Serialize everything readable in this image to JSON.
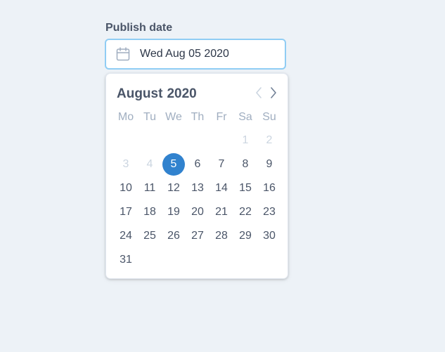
{
  "field": {
    "label": "Publish date",
    "value": "Wed Aug 05 2020",
    "icon": "calendar-icon"
  },
  "calendar": {
    "month": "August",
    "year": "2020",
    "prev_icon": "chevron-left-icon",
    "next_icon": "chevron-right-icon",
    "weekdays": [
      "Mo",
      "Tu",
      "We",
      "Th",
      "Fr",
      "Sa",
      "Su"
    ],
    "weeks": [
      [
        null,
        null,
        null,
        null,
        null,
        "1",
        "2"
      ],
      [
        "3",
        "4",
        "5",
        "6",
        "7",
        "8",
        "9"
      ],
      [
        "10",
        "11",
        "12",
        "13",
        "14",
        "15",
        "16"
      ],
      [
        "17",
        "18",
        "19",
        "20",
        "21",
        "22",
        "23"
      ],
      [
        "24",
        "25",
        "26",
        "27",
        "28",
        "29",
        "30"
      ],
      [
        "31",
        null,
        null,
        null,
        null,
        null,
        null
      ]
    ],
    "selected_day": "5",
    "muted_days": [
      "1",
      "2",
      "3",
      "4"
    ],
    "colors": {
      "accent": "#3182ce",
      "input_focus_border": "#90cdf4",
      "background": "#edf2f7"
    }
  }
}
